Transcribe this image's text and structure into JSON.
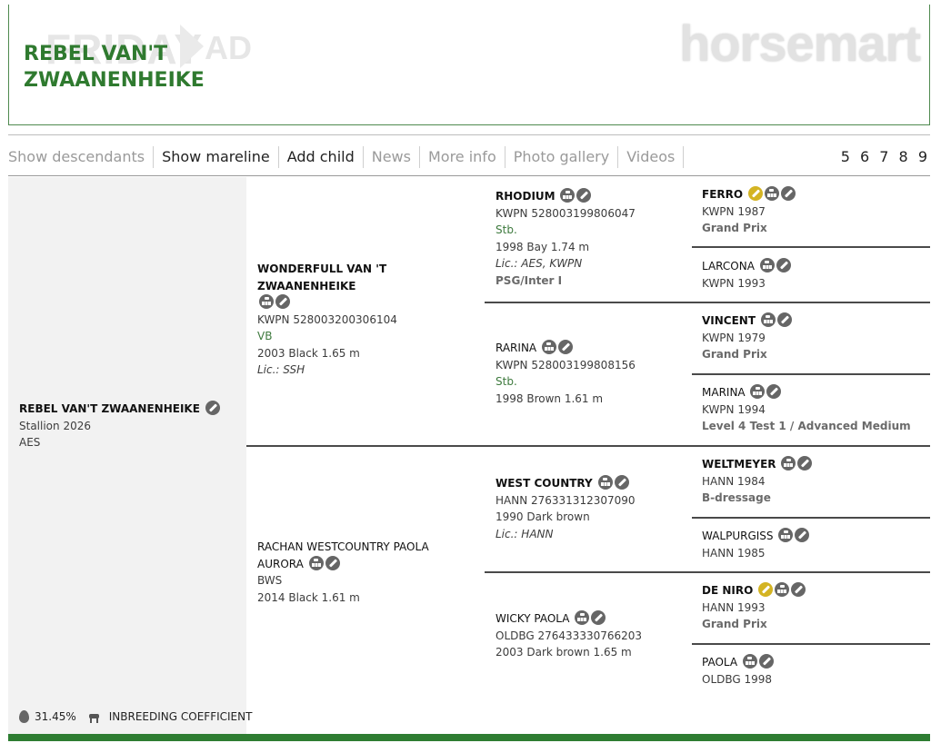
{
  "watermark": {
    "friday": "FRIDAY",
    "ad": "AD",
    "brand": "horsemart"
  },
  "title": "REBEL VAN'T ZWAANENHEIKE",
  "nav": {
    "items": [
      "Show descendants",
      "Show mareline",
      "Add child",
      "News",
      "More info",
      "Photo gallery",
      "Videos"
    ],
    "generations": "5 6 7 8 9"
  },
  "subject": {
    "name": "REBEL VAN'T ZWAANENHEIKE",
    "line1": "Stallion 2026",
    "line2": "AES"
  },
  "sire": {
    "name": "WONDERFULL VAN 'T ZWAANENHEIKE",
    "reg": "KWPN 528003200306104",
    "studbook": "VB",
    "info": "2003 Black 1.65 m",
    "lic": "Lic.: SSH"
  },
  "dam": {
    "name1": "RACHAN WESTCOUNTRY PAOLA",
    "name2": "AURORA",
    "studbook": "BWS",
    "info": "2014 Black 1.61 m"
  },
  "gen2": [
    {
      "name": "RHODIUM",
      "reg": "KWPN 528003199806047",
      "studbook": "Stb.",
      "info": "1998 Bay 1.74 m",
      "lic": "Lic.: AES, KWPN",
      "level": "PSG/Inter I"
    },
    {
      "name": "RARINA",
      "reg": "KWPN 528003199808156",
      "studbook": "Stb.",
      "info": "1998 Brown 1.61 m"
    },
    {
      "name": "WEST COUNTRY",
      "reg": "HANN 276331312307090",
      "info": "1990 Dark brown",
      "lic": "Lic.: HANN"
    },
    {
      "name": "WICKY PAOLA",
      "reg": "OLDBG 276433330766203",
      "info": "2003 Dark brown 1.65 m"
    }
  ],
  "gen3": [
    {
      "name": "FERRO",
      "reg": "KWPN 1987",
      "level": "Grand Prix"
    },
    {
      "name": "LARCONA",
      "reg": "KWPN 1993"
    },
    {
      "name": "VINCENT",
      "reg": "KWPN 1979",
      "level": "Grand Prix"
    },
    {
      "name": "MARINA",
      "reg": "KWPN 1994",
      "level": "Level 4 Test 1 / Advanced Medium"
    },
    {
      "name": "WELTMEYER",
      "reg": "HANN 1984",
      "level": "B-dressage"
    },
    {
      "name": "WALPURGISS",
      "reg": "HANN 1985"
    },
    {
      "name": "DE NIRO",
      "reg": "HANN 1993",
      "level": "Grand Prix"
    },
    {
      "name": "PAOLA",
      "reg": "OLDBG 1998"
    }
  ],
  "inbreeding": {
    "value": "31.45%",
    "label": "INBREEDING COEFFICIENT"
  }
}
